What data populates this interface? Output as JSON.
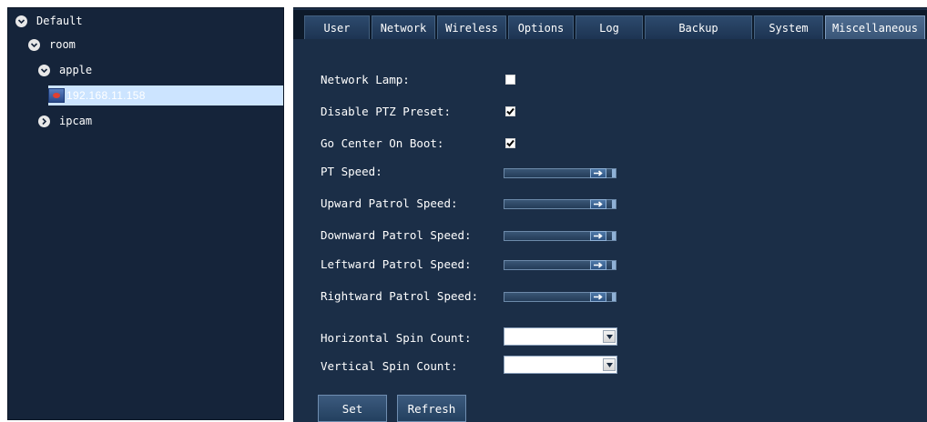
{
  "tree": {
    "root": {
      "label": "Default"
    },
    "room": {
      "label": "room"
    },
    "apple": {
      "label": "apple"
    },
    "device": {
      "label": "192.168.11.158"
    },
    "ipcam": {
      "label": "ipcam"
    }
  },
  "tabs": [
    {
      "label": "User"
    },
    {
      "label": "Network"
    },
    {
      "label": "Wireless"
    },
    {
      "label": "Options"
    },
    {
      "label": "Log"
    },
    {
      "label": "Backup"
    },
    {
      "label": "System"
    },
    {
      "label": "Miscellaneous"
    }
  ],
  "active_tab": "Miscellaneous",
  "settings": {
    "network_lamp": {
      "label": "Network Lamp:",
      "checked": false
    },
    "disable_ptz_preset": {
      "label": "Disable PTZ Preset:",
      "checked": true
    },
    "go_center_on_boot": {
      "label": "Go Center On Boot:",
      "checked": true
    },
    "pt_speed": {
      "label": "PT Speed:",
      "level": 1.0
    },
    "upward_patrol_speed": {
      "label": "Upward Patrol Speed:",
      "level": 1.0
    },
    "downward_patrol_speed": {
      "label": "Downward Patrol Speed:",
      "level": 1.0
    },
    "leftward_patrol_speed": {
      "label": "Leftward Patrol Speed:",
      "level": 1.0
    },
    "rightward_patrol_speed": {
      "label": "Rightward Patrol Speed:",
      "level": 1.0
    },
    "horizontal_spin_count": {
      "label": "Horizontal Spin Count:",
      "value": ""
    },
    "vertical_spin_count": {
      "label": "Vertical Spin Count:",
      "value": ""
    }
  },
  "buttons": {
    "set": "Set",
    "refresh": "Refresh"
  },
  "icons": {
    "expanded": "chevron-down-icon",
    "collapsed": "chevron-right-icon",
    "camera": "camera-icon",
    "dropdown": "dropdown-arrow-icon",
    "checkmark": "checkmark-icon",
    "arrow": "arrow-right-icon"
  },
  "colors": {
    "panel_background": "#1b2e47",
    "sidebar_background": "#15243a",
    "tab_active": "#4e6c90",
    "selection_highlight": "#cce4ff",
    "text": "#ffffff"
  }
}
